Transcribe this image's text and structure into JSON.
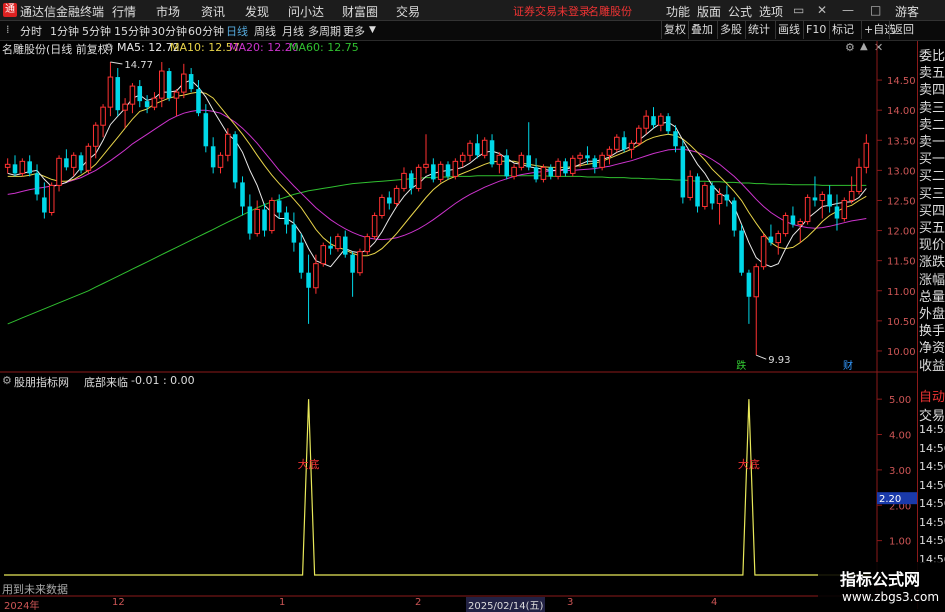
{
  "app": {
    "title": "通达信金融终端",
    "notice": "证券交易未登录",
    "stock_name": "名雕股份"
  },
  "menu": [
    "行情",
    "市场",
    "资讯",
    "发现",
    "问小达",
    "财富圈",
    "交易"
  ],
  "right_menu": [
    "功能",
    "版面",
    "公式",
    "选项"
  ],
  "guest": "游客",
  "periods": [
    "分时",
    "1分钟",
    "5分钟",
    "15分钟",
    "30分钟",
    "60分钟",
    "日线",
    "周线",
    "月线",
    "多周期",
    "更多"
  ],
  "active_period": "日线",
  "tools": [
    "复权",
    "叠加",
    "多股",
    "统计",
    "画线",
    "F10",
    "标记",
    "+自选",
    "返回"
  ],
  "chart_title": "名雕股份(日线 前复权)",
  "ma_legend": {
    "ma5": "MA5: 12.72",
    "ma10": "MA10: 12.57",
    "ma20": "MA20: 12.20",
    "ma60": "MA60: 12.75"
  },
  "colors": {
    "up": "#ff3232",
    "down": "#00d8e8",
    "ma5": "#e8e8e8",
    "ma10": "#e8d44a",
    "ma20": "#cc33cc",
    "ma60": "#30c030",
    "signal": "#e8e85a"
  },
  "quote_panel": [
    "委比",
    "卖五",
    "卖四",
    "卖三",
    "卖二",
    "卖一",
    "买一",
    "买二",
    "买三",
    "买四",
    "买五",
    "现价",
    "涨跌",
    "涨幅",
    "总量",
    "外盘",
    "换手",
    "净资",
    "收益"
  ],
  "indicator": {
    "source": "股朋指标网",
    "name": "底部来临",
    "values": "-0.01 : 0.00",
    "signal_label": "大底",
    "current_value": "2.20"
  },
  "indicator_side": [
    "自动",
    "交易",
    "14:55",
    "14:56",
    "14:56",
    "14:56",
    "14:56",
    "14:56",
    "14:56",
    "14:56"
  ],
  "no_future_tip": "用到未来数据",
  "time_axis": [
    "2024年",
    "12",
    "1",
    "2",
    "2025/02/14(五)",
    "3",
    "4"
  ],
  "markers": {
    "high": "14.77",
    "low": "9.93",
    "limit_down": "跌",
    "finance": "财"
  },
  "watermark": {
    "line1": "指标公式网",
    "line2": "www.zbgs3.com"
  },
  "chart_data": {
    "type": "candlestick",
    "price_axis": [
      14.5,
      14.0,
      13.5,
      13.0,
      12.5,
      12.0,
      11.5,
      11.0,
      10.5,
      10.0
    ],
    "ylim": [
      9.75,
      14.9
    ],
    "candles": [
      [
        13.05,
        13.2,
        12.95,
        13.1
      ],
      [
        13.1,
        13.25,
        12.9,
        12.95
      ],
      [
        12.95,
        13.2,
        12.9,
        13.15
      ],
      [
        13.15,
        13.25,
        12.9,
        12.95
      ],
      [
        12.95,
        13.1,
        12.5,
        12.6
      ],
      [
        12.55,
        12.8,
        12.2,
        12.3
      ],
      [
        12.3,
        12.8,
        12.25,
        12.75
      ],
      [
        12.75,
        13.25,
        12.65,
        13.2
      ],
      [
        13.2,
        13.35,
        13.0,
        13.05
      ],
      [
        13.05,
        13.3,
        12.9,
        13.25
      ],
      [
        13.25,
        13.3,
        12.95,
        13.0
      ],
      [
        13.0,
        13.45,
        12.95,
        13.4
      ],
      [
        13.4,
        13.8,
        13.2,
        13.75
      ],
      [
        13.75,
        14.1,
        13.55,
        14.05
      ],
      [
        14.05,
        14.8,
        13.9,
        14.55
      ],
      [
        14.55,
        14.7,
        13.9,
        14.0
      ],
      [
        14.0,
        14.2,
        13.7,
        14.1
      ],
      [
        14.1,
        14.45,
        13.95,
        14.4
      ],
      [
        14.4,
        14.5,
        14.05,
        14.15
      ],
      [
        14.15,
        14.25,
        13.95,
        14.05
      ],
      [
        14.05,
        14.3,
        14.0,
        14.2
      ],
      [
        14.2,
        14.8,
        14.05,
        14.65
      ],
      [
        14.65,
        14.7,
        14.15,
        14.2
      ],
      [
        14.2,
        14.35,
        13.9,
        14.3
      ],
      [
        14.3,
        14.77,
        14.2,
        14.6
      ],
      [
        14.6,
        14.7,
        14.3,
        14.35
      ],
      [
        14.35,
        14.5,
        13.9,
        13.95
      ],
      [
        13.95,
        14.1,
        13.3,
        13.4
      ],
      [
        13.4,
        13.55,
        12.95,
        13.05
      ],
      [
        13.05,
        13.3,
        12.95,
        13.25
      ],
      [
        13.25,
        13.7,
        13.15,
        13.6
      ],
      [
        13.6,
        13.65,
        12.7,
        12.8
      ],
      [
        12.8,
        12.9,
        12.25,
        12.4
      ],
      [
        12.4,
        12.6,
        11.85,
        11.95
      ],
      [
        11.95,
        12.5,
        11.9,
        12.35
      ],
      [
        12.35,
        12.45,
        11.9,
        12.0
      ],
      [
        12.0,
        12.55,
        11.95,
        12.5
      ],
      [
        12.5,
        12.6,
        12.2,
        12.3
      ],
      [
        12.3,
        12.4,
        11.95,
        12.1
      ],
      [
        12.1,
        12.3,
        11.65,
        11.8
      ],
      [
        11.8,
        11.95,
        11.2,
        11.3
      ],
      [
        11.3,
        11.6,
        10.45,
        11.05
      ],
      [
        11.05,
        11.6,
        10.95,
        11.45
      ],
      [
        11.45,
        11.8,
        11.4,
        11.75
      ],
      [
        11.75,
        11.9,
        11.6,
        11.7
      ],
      [
        11.7,
        11.95,
        11.65,
        11.9
      ],
      [
        11.9,
        12.0,
        11.55,
        11.6
      ],
      [
        11.6,
        11.65,
        10.9,
        11.3
      ],
      [
        11.3,
        11.7,
        11.25,
        11.65
      ],
      [
        11.65,
        11.95,
        11.6,
        11.9
      ],
      [
        11.9,
        12.3,
        11.85,
        12.25
      ],
      [
        12.25,
        12.6,
        12.2,
        12.55
      ],
      [
        12.55,
        12.65,
        12.35,
        12.45
      ],
      [
        12.45,
        12.75,
        12.4,
        12.7
      ],
      [
        12.7,
        13.05,
        12.65,
        12.95
      ],
      [
        12.95,
        13.0,
        12.6,
        12.7
      ],
      [
        12.7,
        13.1,
        12.65,
        13.05
      ],
      [
        13.05,
        13.6,
        12.95,
        13.1
      ],
      [
        13.1,
        13.2,
        12.8,
        12.85
      ],
      [
        12.85,
        13.15,
        12.8,
        13.1
      ],
      [
        13.1,
        13.15,
        12.85,
        12.9
      ],
      [
        12.9,
        13.2,
        12.85,
        13.15
      ],
      [
        13.15,
        13.3,
        13.05,
        13.25
      ],
      [
        13.25,
        13.5,
        13.15,
        13.45
      ],
      [
        13.45,
        13.6,
        13.2,
        13.25
      ],
      [
        13.25,
        13.55,
        13.2,
        13.5
      ],
      [
        13.5,
        13.6,
        13.05,
        13.1
      ],
      [
        13.1,
        13.3,
        12.95,
        13.25
      ],
      [
        13.25,
        13.35,
        12.85,
        12.9
      ],
      [
        12.9,
        13.1,
        12.85,
        13.05
      ],
      [
        13.05,
        13.3,
        13.0,
        13.25
      ],
      [
        13.25,
        13.8,
        13.0,
        13.05
      ],
      [
        13.05,
        13.2,
        12.8,
        12.85
      ],
      [
        12.85,
        13.1,
        12.8,
        13.05
      ],
      [
        13.05,
        13.1,
        12.85,
        12.9
      ],
      [
        12.9,
        13.2,
        12.85,
        13.15
      ],
      [
        13.15,
        13.2,
        12.9,
        12.95
      ],
      [
        12.95,
        13.25,
        12.9,
        13.2
      ],
      [
        13.2,
        13.3,
        13.05,
        13.25
      ],
      [
        13.25,
        13.4,
        13.1,
        13.2
      ],
      [
        13.2,
        13.25,
        12.95,
        13.05
      ],
      [
        13.05,
        13.3,
        13.0,
        13.25
      ],
      [
        13.25,
        13.4,
        13.1,
        13.35
      ],
      [
        13.35,
        13.6,
        13.3,
        13.55
      ],
      [
        13.55,
        13.65,
        13.3,
        13.35
      ],
      [
        13.35,
        13.5,
        13.2,
        13.45
      ],
      [
        13.45,
        13.75,
        13.4,
        13.7
      ],
      [
        13.7,
        14.0,
        13.6,
        13.9
      ],
      [
        13.9,
        14.05,
        13.7,
        13.75
      ],
      [
        13.75,
        13.95,
        13.65,
        13.9
      ],
      [
        13.9,
        13.95,
        13.6,
        13.65
      ],
      [
        13.65,
        13.75,
        13.3,
        13.4
      ],
      [
        13.4,
        13.5,
        12.45,
        12.55
      ],
      [
        12.55,
        13.0,
        12.5,
        12.9
      ],
      [
        12.9,
        12.95,
        12.3,
        12.4
      ],
      [
        12.4,
        12.8,
        12.35,
        12.75
      ],
      [
        12.75,
        12.8,
        12.35,
        12.45
      ],
      [
        12.45,
        12.7,
        12.1,
        12.6
      ],
      [
        12.6,
        12.75,
        12.4,
        12.5
      ],
      [
        12.5,
        12.55,
        11.9,
        12.0
      ],
      [
        12.0,
        12.1,
        11.25,
        11.3
      ],
      [
        11.3,
        11.35,
        10.45,
        10.9
      ],
      [
        10.9,
        11.45,
        9.93,
        11.4
      ],
      [
        11.4,
        11.95,
        11.35,
        11.9
      ],
      [
        11.9,
        12.1,
        11.75,
        11.8
      ],
      [
        11.8,
        12.0,
        11.6,
        11.95
      ],
      [
        11.95,
        12.3,
        11.9,
        12.25
      ],
      [
        12.25,
        12.4,
        12.05,
        12.1
      ],
      [
        12.1,
        12.2,
        11.8,
        12.15
      ],
      [
        12.15,
        12.6,
        12.1,
        12.55
      ],
      [
        12.55,
        12.9,
        12.4,
        12.5
      ],
      [
        12.5,
        12.65,
        12.2,
        12.6
      ],
      [
        12.6,
        12.75,
        12.3,
        12.4
      ],
      [
        12.4,
        12.6,
        12.0,
        12.2
      ],
      [
        12.2,
        12.55,
        12.15,
        12.5
      ],
      [
        12.5,
        12.9,
        12.45,
        12.65
      ],
      [
        12.65,
        13.2,
        12.6,
        13.05
      ],
      [
        13.05,
        13.6,
        12.95,
        13.45
      ]
    ],
    "ma5": [
      12.95,
      12.92,
      12.95,
      12.98,
      13.0,
      12.85,
      12.73,
      12.76,
      12.8,
      12.9,
      13.05,
      13.18,
      13.28,
      13.5,
      13.76,
      13.9,
      14.03,
      14.2,
      14.25,
      14.16,
      14.2,
      14.3,
      14.3,
      14.32,
      14.45,
      14.5,
      14.38,
      14.22,
      14.0,
      13.8,
      13.6,
      13.5,
      13.3,
      13.0,
      12.75,
      12.42,
      12.3,
      12.2,
      12.2,
      12.12,
      11.95,
      11.7,
      11.5,
      11.45,
      11.4,
      11.55,
      11.7,
      11.65,
      11.63,
      11.68,
      11.8,
      11.98,
      12.2,
      12.4,
      12.57,
      12.7,
      12.78,
      12.9,
      12.95,
      12.98,
      13.0,
      13.02,
      13.05,
      13.12,
      13.22,
      13.3,
      13.32,
      13.28,
      13.2,
      13.12,
      13.1,
      13.06,
      13.04,
      13.02,
      13.0,
      13.0,
      13.02,
      13.05,
      13.1,
      13.15,
      13.15,
      13.18,
      13.22,
      13.3,
      13.35,
      13.4,
      13.5,
      13.6,
      13.7,
      13.78,
      13.8,
      13.72,
      13.5,
      13.3,
      13.1,
      12.95,
      12.75,
      12.62,
      12.55,
      12.4,
      12.1,
      11.8,
      11.55,
      11.45,
      11.4,
      11.45,
      11.7,
      11.92,
      12.05,
      12.2,
      12.3,
      12.4,
      12.42,
      12.45,
      12.47,
      12.48,
      12.55,
      12.7
    ],
    "ma10": [
      12.9,
      12.9,
      12.9,
      12.92,
      12.95,
      12.9,
      12.85,
      12.82,
      12.82,
      12.85,
      12.92,
      13.0,
      13.1,
      13.25,
      13.4,
      13.55,
      13.7,
      13.85,
      13.98,
      14.02,
      14.1,
      14.15,
      14.2,
      14.23,
      14.25,
      14.28,
      14.3,
      14.28,
      14.2,
      14.05,
      13.9,
      13.75,
      13.6,
      13.43,
      13.25,
      13.08,
      12.92,
      12.78,
      12.65,
      12.52,
      12.38,
      12.2,
      12.02,
      11.88,
      11.78,
      11.72,
      11.68,
      11.62,
      11.58,
      11.58,
      11.62,
      11.7,
      11.82,
      11.95,
      12.1,
      12.25,
      12.4,
      12.55,
      12.68,
      12.78,
      12.85,
      12.9,
      12.95,
      13.0,
      13.05,
      13.1,
      13.14,
      13.15,
      13.15,
      13.15,
      13.12,
      13.1,
      13.08,
      13.06,
      13.05,
      13.05,
      13.05,
      13.06,
      13.08,
      13.1,
      13.12,
      13.15,
      13.2,
      13.25,
      13.3,
      13.35,
      13.42,
      13.5,
      13.55,
      13.58,
      13.6,
      13.58,
      13.52,
      13.42,
      13.3,
      13.17,
      13.02,
      12.9,
      12.78,
      12.65,
      12.5,
      12.3,
      12.12,
      11.95,
      11.8,
      11.72,
      11.7,
      11.72,
      11.8,
      11.9,
      12.02,
      12.15,
      12.25,
      12.32,
      12.38,
      12.42,
      12.5,
      12.57
    ],
    "ma20": [
      12.6,
      12.62,
      12.65,
      12.68,
      12.7,
      12.72,
      12.74,
      12.76,
      12.8,
      12.84,
      12.88,
      12.94,
      13.0,
      13.08,
      13.16,
      13.25,
      13.34,
      13.44,
      13.52,
      13.6,
      13.68,
      13.76,
      13.84,
      13.9,
      13.95,
      13.98,
      14.0,
      14.0,
      13.98,
      13.95,
      13.88,
      13.8,
      13.7,
      13.58,
      13.45,
      13.3,
      13.15,
      13.0,
      12.87,
      12.74,
      12.62,
      12.5,
      12.38,
      12.28,
      12.18,
      12.1,
      12.03,
      11.97,
      11.92,
      11.88,
      11.86,
      11.85,
      11.86,
      11.88,
      11.92,
      11.97,
      12.03,
      12.1,
      12.18,
      12.27,
      12.36,
      12.45,
      12.53,
      12.6,
      12.66,
      12.72,
      12.77,
      12.82,
      12.86,
      12.9,
      12.93,
      12.95,
      12.97,
      12.98,
      12.99,
      13.0,
      13.0,
      13.0,
      13.01,
      13.02,
      13.03,
      13.05,
      13.07,
      13.1,
      13.13,
      13.16,
      13.2,
      13.24,
      13.28,
      13.31,
      13.34,
      13.35,
      13.35,
      13.33,
      13.3,
      13.25,
      13.18,
      13.1,
      13.0,
      12.9,
      12.78,
      12.65,
      12.52,
      12.4,
      12.3,
      12.22,
      12.15,
      12.1,
      12.07,
      12.05,
      12.04,
      12.05,
      12.07,
      12.1,
      12.13,
      12.16,
      12.18,
      12.2
    ],
    "ma60": [
      10.45,
      10.5,
      10.55,
      10.6,
      10.65,
      10.7,
      10.75,
      10.8,
      10.85,
      10.9,
      10.95,
      11.0,
      11.06,
      11.12,
      11.18,
      11.24,
      11.3,
      11.36,
      11.42,
      11.48,
      11.54,
      11.6,
      11.66,
      11.72,
      11.78,
      11.84,
      11.9,
      11.96,
      12.02,
      12.08,
      12.14,
      12.2,
      12.26,
      12.32,
      12.38,
      12.43,
      12.48,
      12.52,
      12.56,
      12.6,
      12.63,
      12.66,
      12.68,
      12.7,
      12.72,
      12.74,
      12.76,
      12.78,
      12.79,
      12.8,
      12.81,
      12.82,
      12.83,
      12.84,
      12.85,
      12.86,
      12.87,
      12.88,
      12.88,
      12.89,
      12.89,
      12.9,
      12.9,
      12.9,
      12.91,
      12.91,
      12.91,
      12.91,
      12.91,
      12.91,
      12.91,
      12.91,
      12.91,
      12.91,
      12.9,
      12.9,
      12.9,
      12.9,
      12.9,
      12.89,
      12.89,
      12.89,
      12.88,
      12.88,
      12.88,
      12.87,
      12.87,
      12.86,
      12.86,
      12.85,
      12.85,
      12.84,
      12.84,
      12.83,
      12.82,
      12.82,
      12.81,
      12.81,
      12.8,
      12.8,
      12.79,
      12.79,
      12.78,
      12.78,
      12.77,
      12.77,
      12.77,
      12.76,
      12.76,
      12.76,
      12.76,
      12.75,
      12.75,
      12.75,
      12.75,
      12.75,
      12.75,
      12.75
    ],
    "signal_axis": [
      5.0,
      4.0,
      3.0,
      2.0,
      1.0
    ],
    "signal_ylim": [
      0,
      5.4
    ],
    "signal_spikes": [
      {
        "index": 41,
        "value": 5.0
      },
      {
        "index": 101,
        "value": 5.0
      }
    ]
  }
}
